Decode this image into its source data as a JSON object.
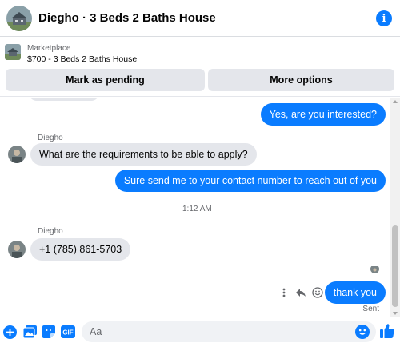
{
  "header": {
    "title": "Diegho · 3 Beds 2 Baths House",
    "info_icon": "info-icon"
  },
  "marketplace": {
    "label": "Marketplace",
    "item": "$700 - 3 Beds 2 Baths House",
    "actions": {
      "pending_label": "Mark as pending",
      "more_label": "More options"
    }
  },
  "messages": [
    {
      "direction": "out",
      "text": "Yes, are you interested?"
    },
    {
      "direction": "in",
      "sender": "Diegho",
      "text": "What are the requirements to be able to apply?"
    },
    {
      "direction": "out",
      "text": "Sure send me to your contact number to reach out of you"
    },
    {
      "timestamp": "1:12 AM"
    },
    {
      "direction": "in",
      "sender": "Diegho",
      "text": "+1 (785) 861-5703"
    },
    {
      "direction": "out",
      "text": "thank you",
      "status": "Sent"
    }
  ],
  "composer": {
    "placeholder": "Aa",
    "icons": [
      "plus-icon",
      "photo-icon",
      "sticker-icon",
      "gif-icon",
      "emoji-icon",
      "like-icon"
    ]
  },
  "colors": {
    "accent": "#0a7cff",
    "bubble_in": "#e4e6eb",
    "button_bg": "#e4e6eb"
  }
}
